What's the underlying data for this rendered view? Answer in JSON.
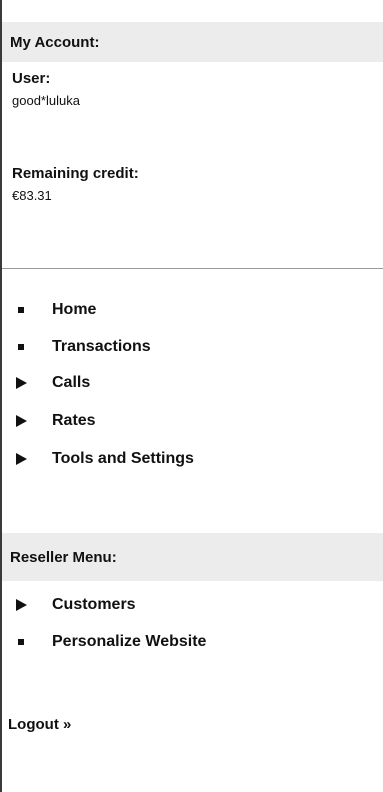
{
  "account": {
    "header": "My Account:",
    "user_label": "User:",
    "user_value": "good*luluka",
    "credit_label": "Remaining credit:",
    "credit_value": "€83.31"
  },
  "main_menu": {
    "items": [
      {
        "label": "Home",
        "marker": "square-bullet-icon"
      },
      {
        "label": "Transactions",
        "marker": "square-bullet-icon"
      },
      {
        "label": "Calls",
        "marker": "arrow-right-icon"
      },
      {
        "label": "Rates",
        "marker": "arrow-right-icon"
      },
      {
        "label": "Tools and Settings",
        "marker": "arrow-right-icon"
      }
    ]
  },
  "reseller": {
    "header": "Reseller Menu:",
    "items": [
      {
        "label": "Customers",
        "marker": "arrow-right-icon"
      },
      {
        "label": "Personalize Website",
        "marker": "square-bullet-icon"
      }
    ]
  },
  "logout": {
    "label": "Logout »"
  }
}
